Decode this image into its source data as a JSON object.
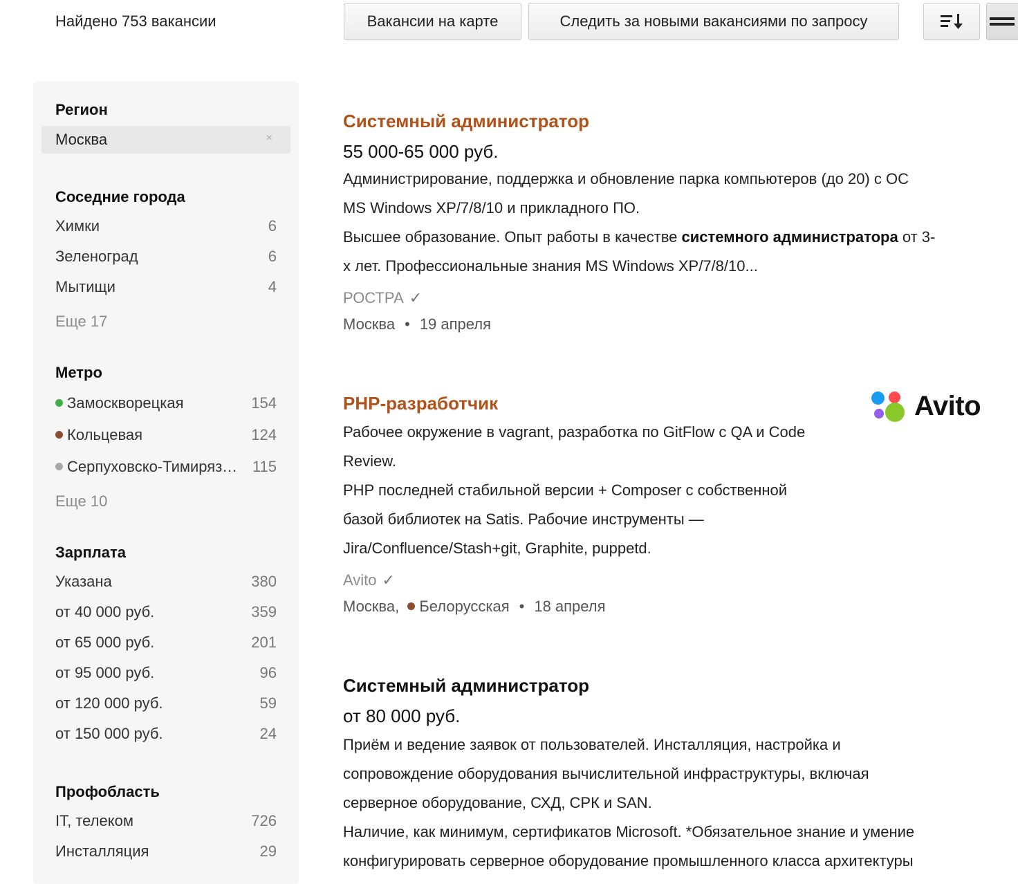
{
  "header": {
    "found": "Найдено 753 вакансии",
    "map_button": "Вакансии на карте",
    "follow_button": "Следить за новыми вакансиями по запросу",
    "sort_icon": "sort-icon",
    "view_icon": "list-view-icon"
  },
  "sidebar": {
    "region": {
      "title": "Регион",
      "selected": "Москва",
      "remove": "×"
    },
    "nearby": {
      "title": "Соседние города",
      "items": [
        {
          "label": "Химки",
          "count": "6"
        },
        {
          "label": "Зеленоград",
          "count": "6"
        },
        {
          "label": "Мытищи",
          "count": "4"
        }
      ],
      "more": "Еще 17"
    },
    "metro": {
      "title": "Метро",
      "items": [
        {
          "label": "Замоскворецкая",
          "count": "154",
          "color": "#3fae49"
        },
        {
          "label": "Кольцевая",
          "count": "124",
          "color": "#8d4b2f"
        },
        {
          "label": "Серпуховско-Тимирязевская",
          "count": "115",
          "color": "#a8a8a8"
        }
      ],
      "more": "Еще 10"
    },
    "salary": {
      "title": "Зарплата",
      "items": [
        {
          "label": "Указана",
          "count": "380"
        },
        {
          "label": "от 40 000 руб.",
          "count": "359"
        },
        {
          "label": "от 65 000 руб.",
          "count": "201"
        },
        {
          "label": "от 95 000 руб.",
          "count": "96"
        },
        {
          "label": "от 120 000 руб.",
          "count": "59"
        },
        {
          "label": "от 150 000 руб.",
          "count": "24"
        }
      ]
    },
    "prof": {
      "title": "Профобласть",
      "items": [
        {
          "label": "IT, телеком",
          "count": "726"
        },
        {
          "label": "Инсталляция",
          "count": "29"
        }
      ]
    }
  },
  "jobs": [
    {
      "title": "Системный администратор",
      "salary": "55 000-65 000 руб.",
      "desc_line1": "Администрирование, поддержка и обновление парка компьютеров (до 20) с ОС",
      "desc_line2": "MS Windows XP/7/8/10 и прикладного ПО.",
      "desc_line3_pre": "Высшее образование. Опыт работы в качестве ",
      "desc_line3_bold": "системного администратора",
      "desc_line3_post": " от 3-",
      "desc_line4": "х лет. Профессиональные знания MS Windows XP/7/8/10...",
      "company": "РОСТРА",
      "city": "Москва",
      "date": "19 апреля"
    },
    {
      "title": "PHP-разработчик",
      "desc_lines": [
        "Рабочее окружение в vagrant, разработка по GitFlow с QA и Code",
        "Review.",
        "PHP последней стабильной версии + Composer с собственной",
        "базой библиотек на Satis. Рабочие инструменты —",
        "Jira/Confluence/Stash+git, Graphite, puppetd."
      ],
      "company": "Avito",
      "city": "Москва,",
      "metro": "Белорусская",
      "metro_color": "#8d4b2f",
      "date": "18 апреля",
      "logo_text": "Avito"
    },
    {
      "title": "Системный администратор",
      "salary": "от 80 000 руб.",
      "desc_lines": [
        "Приём и ведение заявок от пользователей. Инсталляция, настройка и",
        "сопровождение оборудования вычислительной инфраструктуры, включая",
        "серверное оборудование, СХД, СРК и SAN.",
        "Наличие, как минимум, сертификатов Microsoft. *Обязательное знание и умение",
        "конфигурировать серверное оборудование промышленного класса архитектуры"
      ]
    }
  ]
}
